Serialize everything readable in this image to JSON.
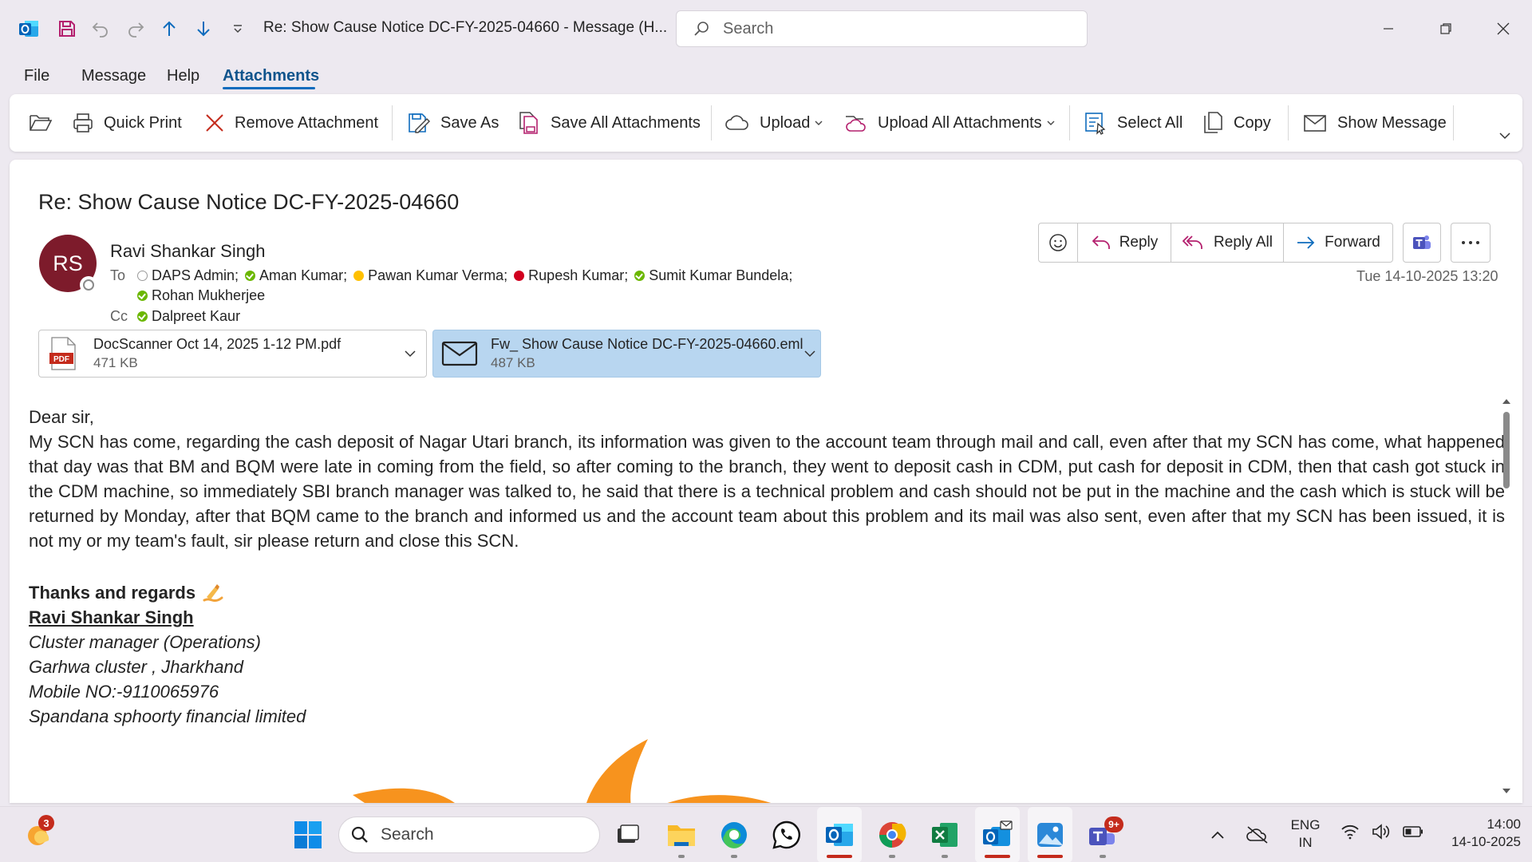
{
  "window": {
    "title": "Re: Show Cause Notice DC-FY-2025-04660  -  Message (H...",
    "search_placeholder": "Search"
  },
  "menu": [
    {
      "label": "File"
    },
    {
      "label": "Message"
    },
    {
      "label": "Help"
    },
    {
      "label": "Attachments",
      "active": true
    }
  ],
  "ribbon": {
    "quick_print": "Quick Print",
    "remove_attachment": "Remove Attachment",
    "save_as": "Save As",
    "save_all": "Save All Attachments",
    "upload": "Upload",
    "upload_all": "Upload All Attachments",
    "select_all": "Select All",
    "copy": "Copy",
    "show_message": "Show Message"
  },
  "message": {
    "subject": "Re: Show Cause Notice DC-FY-2025-04660",
    "sender_initials": "RS",
    "sender_name": "Ravi Shankar Singh",
    "to_label": "To",
    "cc_label": "Cc",
    "to": [
      {
        "name": "DAPS Admin;",
        "status": "offline"
      },
      {
        "name": "Aman Kumar;",
        "status": "available"
      },
      {
        "name": "Pawan Kumar Verma;",
        "status": "away"
      },
      {
        "name": "Rupesh Kumar;",
        "status": "busy"
      },
      {
        "name": "Sumit Kumar Bundela;",
        "status": "available"
      },
      {
        "name": "Rohan Mukherjee",
        "status": "available"
      }
    ],
    "cc": [
      {
        "name": "Dalpreet Kaur",
        "status": "available"
      }
    ],
    "date": "Tue 14-10-2025 13:20",
    "actions": {
      "reply": "Reply",
      "reply_all": "Reply All",
      "forward": "Forward"
    },
    "attachments": [
      {
        "name": "DocScanner Oct 14, 2025 1-12 PM.pdf",
        "size": "471 KB",
        "type": "pdf",
        "selected": false
      },
      {
        "name": "Fw_ Show Cause Notice DC-FY-2025-04660.eml",
        "size": "487 KB",
        "type": "eml",
        "selected": true
      }
    ],
    "body": {
      "greeting": "Dear sir,",
      "paragraph": "My SCN has come, regarding the cash deposit of Nagar Utari branch, its information was given to the account team through mail and call, even after that my SCN has come, what happened that day was that BM and BQM were late in coming from the field, so after coming to the branch, they went to deposit cash in CDM, put cash for deposit in CDM, then that cash got stuck in the CDM machine, so immediately SBI branch manager was talked to, he said that there is a technical problem and cash should not be put in the machine and the cash which is stuck will be returned by Monday, after that BQM came to the branch and informed us and the account team about this problem and its mail was also sent, even after that my SCN has been issued, it is not my or my team's fault, sir please return and close this SCN."
    },
    "signature": {
      "thanks": "Thanks and regards",
      "name": "Ravi Shankar Singh ",
      "role": "Cluster manager (Operations)",
      "cluster": "Garhwa cluster , Jharkhand",
      "mobile": "Mobile NO:-9110065976",
      "company": "Spandana sphoorty financial limited"
    }
  },
  "taskbar": {
    "widget_badge": "3",
    "search_placeholder": "Search",
    "teams_badge": "9+",
    "lang_line1": "ENG",
    "lang_line2": "IN",
    "time": "14:00",
    "date": "14-10-2025"
  },
  "colors": {
    "accent": "#0f6cbd",
    "avatar": "#7d1b2b",
    "selected_attachment": "#b8d6f0"
  }
}
